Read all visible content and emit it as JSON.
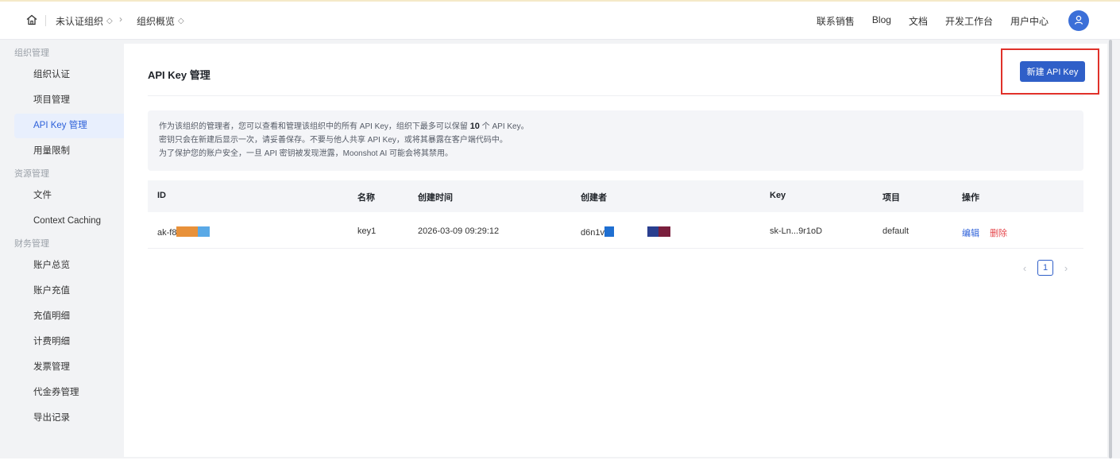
{
  "topbar": {
    "org_label": "未认证组织",
    "overview_label": "组织概览",
    "links": [
      "联系销售",
      "Blog",
      "文档",
      "开发工作台",
      "用户中心"
    ]
  },
  "sidebar": {
    "groups": [
      {
        "title": "组织管理",
        "items": [
          {
            "label": "组织认证",
            "active": false
          },
          {
            "label": "项目管理",
            "active": false
          },
          {
            "label": "API Key 管理",
            "active": true
          },
          {
            "label": "用量限制",
            "active": false
          }
        ]
      },
      {
        "title": "资源管理",
        "items": [
          {
            "label": "文件",
            "active": false
          },
          {
            "label": "Context Caching",
            "active": false
          }
        ]
      },
      {
        "title": "财务管理",
        "items": [
          {
            "label": "账户总览",
            "active": false
          },
          {
            "label": "账户充值",
            "active": false
          },
          {
            "label": "充值明细",
            "active": false
          },
          {
            "label": "计费明细",
            "active": false
          },
          {
            "label": "发票管理",
            "active": false
          },
          {
            "label": "代金券管理",
            "active": false
          },
          {
            "label": "导出记录",
            "active": false
          }
        ]
      }
    ]
  },
  "main": {
    "title": "API Key 管理",
    "new_key_button": "新建 API Key",
    "notice": {
      "line1_prefix": "作为该组织的管理者，您可以查看和管理该组织中的所有 API Key，组织下最多可以保留 ",
      "line1_count": "10",
      "line1_suffix": " 个 API Key。",
      "line2": "密钥只会在新建后显示一次，请妥善保存。不要与他人共享 API Key，或将其暴露在客户端代码中。",
      "line3": "为了保护您的账户安全，一旦 API 密钥被发现泄露，Moonshot AI 可能会将其禁用。"
    },
    "table": {
      "headers": [
        "ID",
        "名称",
        "创建时间",
        "创建者",
        "Key",
        "项目",
        "操作"
      ],
      "rows": [
        {
          "id": "ak-f8",
          "name": "key1",
          "created_at": "2026-03-09 09:29:12",
          "creator": "d6n1v",
          "key": "sk-Ln...9r1oD",
          "project": "default",
          "edit": "编辑",
          "delete": "删除"
        }
      ]
    },
    "pagination": {
      "current": "1"
    }
  },
  "colors": {
    "primary": "#2f5fc8",
    "danger": "#e0312a",
    "active_bg": "#e8effd",
    "link": "#2b5fd9",
    "delete": "#e5484d",
    "mask_orange": "#e8913a",
    "mask_lightblue": "#5aa9e6",
    "mask_blue": "#1f6fd1",
    "mask_navy": "#2a3f8f",
    "mask_maroon": "#7a1f3d"
  },
  "icons": [
    "home-icon",
    "chevron-down-icon",
    "chevron-right-icon",
    "user-icon",
    "chevron-left-icon"
  ]
}
